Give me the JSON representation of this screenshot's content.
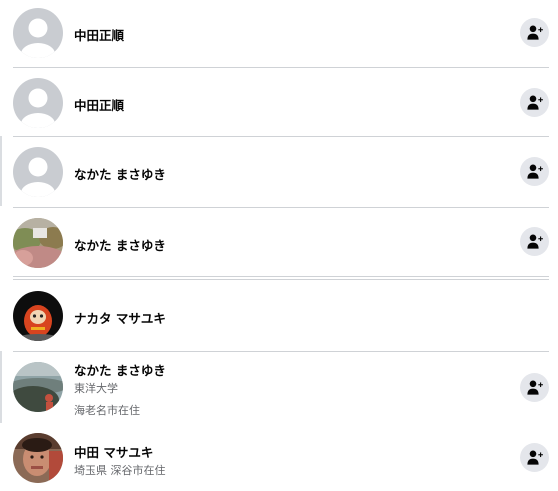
{
  "people": [
    {
      "name": "中田正順",
      "avatar": "default-avatar-icon",
      "add_icon": "add-friend-icon"
    },
    {
      "name": "中田正順",
      "avatar": "default-avatar-icon",
      "add_icon": "add-friend-icon"
    },
    {
      "name": "なかた まさゆき",
      "avatar": "default-avatar-icon",
      "add_icon": "add-friend-icon"
    },
    {
      "name": "なかた まさゆき",
      "avatar": "landscape-photo",
      "add_icon": "add-friend-icon"
    },
    {
      "name": "ナカタ マサユキ",
      "avatar": "daruma-photo"
    },
    {
      "name": "なかた まさゆき",
      "sub1": "東洋大学",
      "sub2": "海老名市在住",
      "avatar": "rocky-shore-photo",
      "add_icon": "add-friend-icon"
    },
    {
      "name": "中田 マサユキ",
      "sub1": "埼玉県 深谷市在住",
      "avatar": "face-photo",
      "add_icon": "add-friend-icon"
    }
  ],
  "colors": {
    "button_bg": "#e4e6eb",
    "icon": "#050505",
    "divider": "#cfd2d6",
    "default_avatar_bg": "#c9ccd1",
    "secondary_text": "#65676b"
  }
}
